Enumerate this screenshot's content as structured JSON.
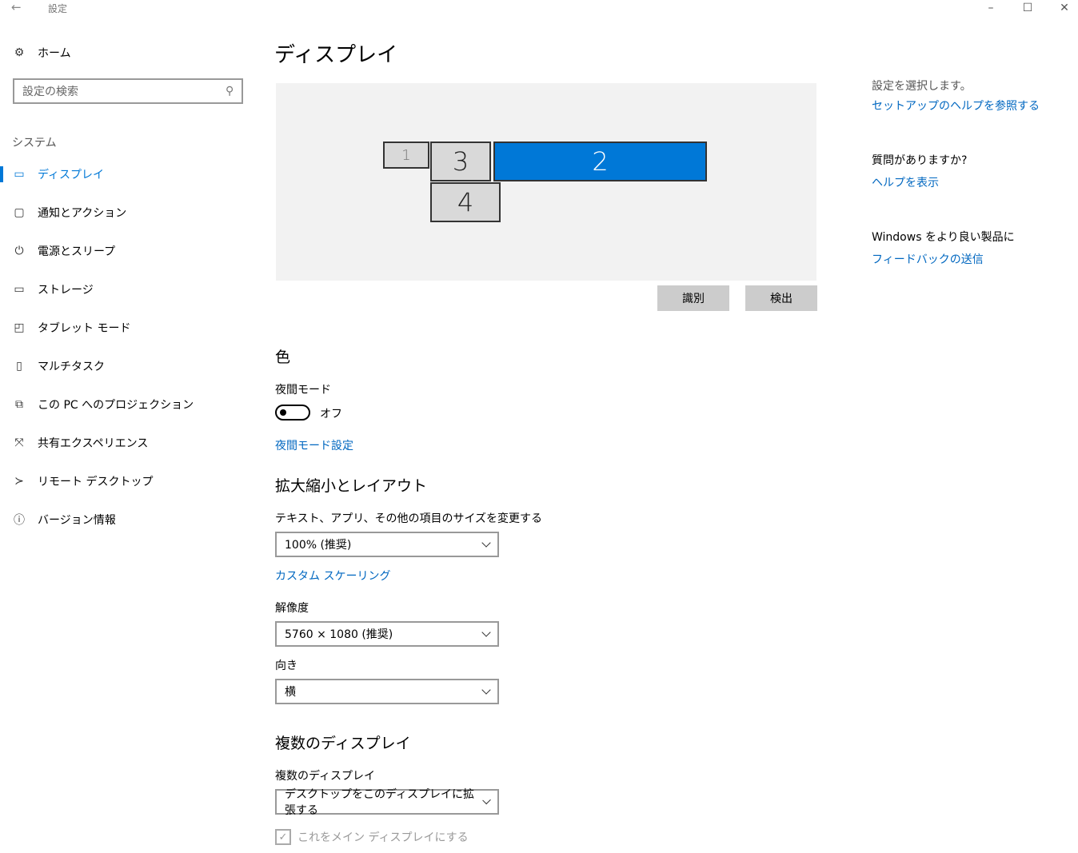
{
  "window": {
    "title": "設定",
    "back_icon": "back-arrow-icon",
    "controls": [
      "minimize-icon",
      "maximize-icon",
      "close-icon"
    ]
  },
  "sidebar": {
    "home": {
      "label": "ホーム",
      "icon": "gear-icon"
    },
    "search": {
      "placeholder": "設定の検索",
      "icon": "search-icon"
    },
    "section": "システム",
    "items": [
      {
        "label": "ディスプレイ",
        "icon": "monitor-icon",
        "active": true
      },
      {
        "label": "通知とアクション",
        "icon": "notification-icon"
      },
      {
        "label": "電源とスリープ",
        "icon": "power-icon"
      },
      {
        "label": "ストレージ",
        "icon": "storage-icon"
      },
      {
        "label": "タブレット モード",
        "icon": "tablet-mode-icon"
      },
      {
        "label": "マルチタスク",
        "icon": "multitask-icon"
      },
      {
        "label": "この PC へのプロジェクション",
        "icon": "projection-icon"
      },
      {
        "label": "共有エクスペリエンス",
        "icon": "shared-experience-icon"
      },
      {
        "label": "リモート デスクトップ",
        "icon": "remote-desktop-icon"
      },
      {
        "label": "バージョン情報",
        "icon": "info-icon"
      }
    ]
  },
  "main": {
    "title": "ディスプレイ",
    "monitors": [
      {
        "label": "1"
      },
      {
        "label": "3"
      },
      {
        "label": "2",
        "selected": true
      },
      {
        "label": "4"
      }
    ],
    "identify_button": "識別",
    "detect_button": "検出",
    "color": {
      "heading": "色",
      "night_mode_label": "夜間モード",
      "night_mode_state": "オフ",
      "night_mode_on": false,
      "night_mode_settings_link": "夜間モード設定"
    },
    "scale": {
      "heading": "拡大縮小とレイアウト",
      "size_label": "テキスト、アプリ、その他の項目のサイズを変更する",
      "size_value": "100% (推奨)",
      "custom_scaling_link": "カスタム スケーリング",
      "resolution_label": "解像度",
      "resolution_value": "5760 × 1080 (推奨)",
      "orientation_label": "向き",
      "orientation_value": "横"
    },
    "multi": {
      "heading": "複数のディスプレイ",
      "label": "複数のディスプレイ",
      "value": "デスクトップをこのディスプレイに拡張する",
      "main_display_checkbox": "これをメイン ディスプレイにする",
      "main_display_checked": true
    }
  },
  "right_panel": {
    "text": "設定を選択します。",
    "setup_help_link": "セットアップのヘルプを参照する",
    "question_heading": "質問がありますか?",
    "help_link": "ヘルプを表示",
    "feedback_heading": "Windows をより良い製品に",
    "feedback_link": "フィードバックの送信"
  },
  "colors": {
    "accent": "#0078d7",
    "link": "#0067c0",
    "preview_bg": "#f2f2f2",
    "button_bg": "#cccccc"
  }
}
